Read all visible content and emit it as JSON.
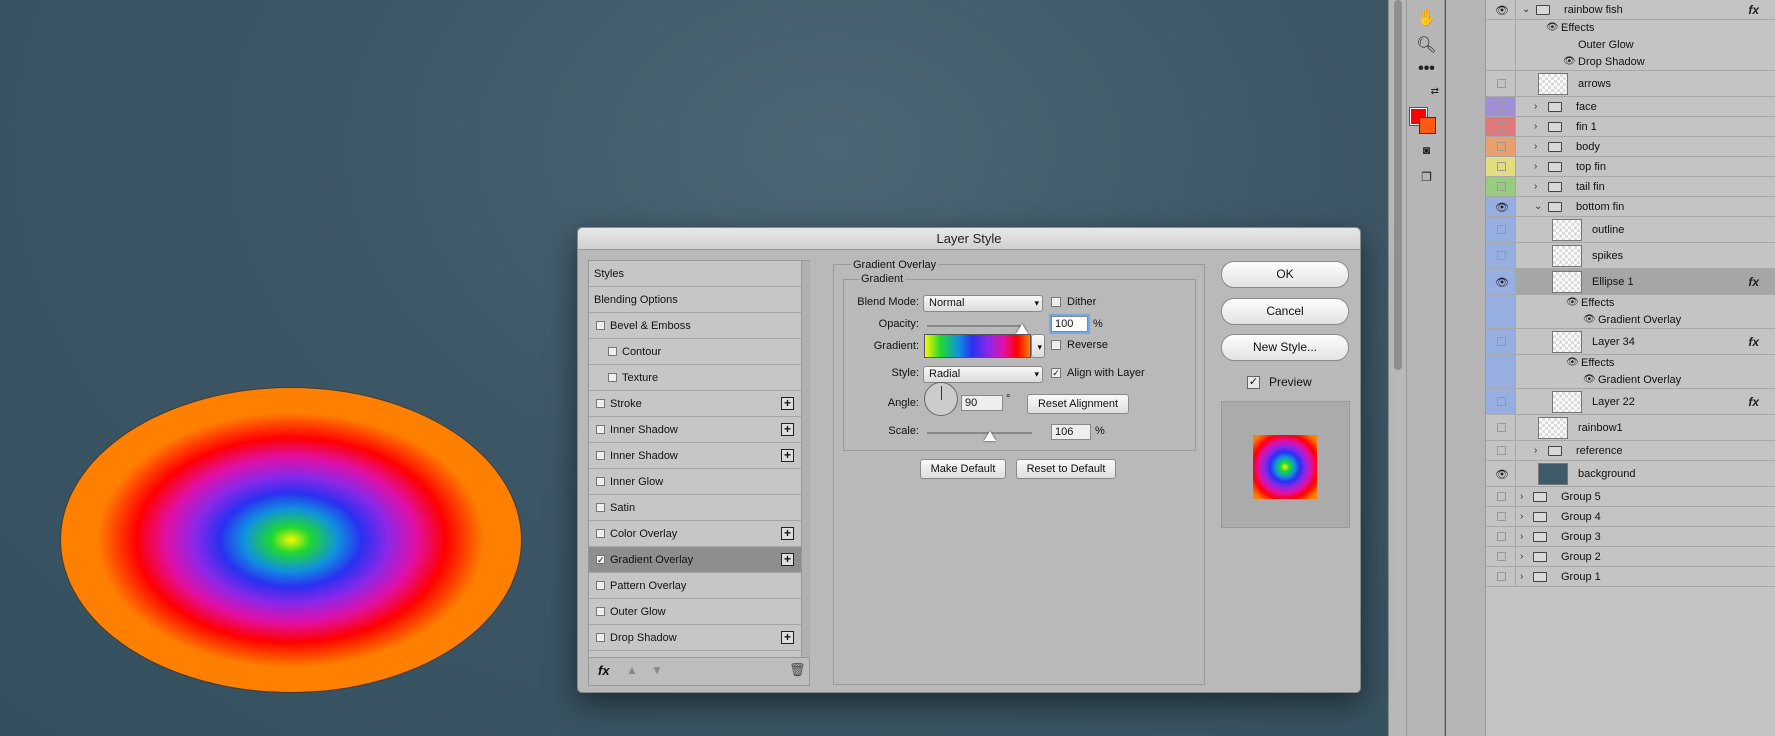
{
  "dialog": {
    "title": "Layer Style",
    "styles_list": [
      {
        "label": "Styles",
        "checkbox": false,
        "checked": false,
        "plus": false,
        "indent": 0,
        "selected": false
      },
      {
        "label": "Blending Options",
        "checkbox": false,
        "checked": false,
        "plus": false,
        "indent": 0,
        "selected": false
      },
      {
        "label": "Bevel & Emboss",
        "checkbox": true,
        "checked": false,
        "plus": false,
        "indent": 1,
        "selected": false
      },
      {
        "label": "Contour",
        "checkbox": true,
        "checked": false,
        "plus": false,
        "indent": 2,
        "selected": false
      },
      {
        "label": "Texture",
        "checkbox": true,
        "checked": false,
        "plus": false,
        "indent": 2,
        "selected": false
      },
      {
        "label": "Stroke",
        "checkbox": true,
        "checked": false,
        "plus": true,
        "indent": 1,
        "selected": false
      },
      {
        "label": "Inner Shadow",
        "checkbox": true,
        "checked": false,
        "plus": true,
        "indent": 1,
        "selected": false
      },
      {
        "label": "Inner Shadow",
        "checkbox": true,
        "checked": false,
        "plus": true,
        "indent": 1,
        "selected": false
      },
      {
        "label": "Inner Glow",
        "checkbox": true,
        "checked": false,
        "plus": false,
        "indent": 1,
        "selected": false
      },
      {
        "label": "Satin",
        "checkbox": true,
        "checked": false,
        "plus": false,
        "indent": 1,
        "selected": false
      },
      {
        "label": "Color Overlay",
        "checkbox": true,
        "checked": false,
        "plus": true,
        "indent": 1,
        "selected": false
      },
      {
        "label": "Gradient Overlay",
        "checkbox": true,
        "checked": true,
        "plus": true,
        "indent": 1,
        "selected": true
      },
      {
        "label": "Pattern Overlay",
        "checkbox": true,
        "checked": false,
        "plus": false,
        "indent": 1,
        "selected": false
      },
      {
        "label": "Outer Glow",
        "checkbox": true,
        "checked": false,
        "plus": false,
        "indent": 1,
        "selected": false
      },
      {
        "label": "Drop Shadow",
        "checkbox": true,
        "checked": false,
        "plus": true,
        "indent": 1,
        "selected": false
      }
    ],
    "footer": {
      "fx_label": "fx",
      "up_icon": "arrow-up-icon",
      "down_icon": "arrow-down-icon",
      "trash_icon": "trash-icon"
    },
    "section_title": "Gradient Overlay",
    "group_title": "Gradient",
    "blend_mode": {
      "label": "Blend Mode:",
      "value": "Normal"
    },
    "dither": {
      "label": "Dither",
      "checked": false
    },
    "opacity": {
      "label": "Opacity:",
      "value": "100",
      "unit": "%",
      "level": 1.0
    },
    "gradient": {
      "label": "Gradient:"
    },
    "reverse": {
      "label": "Reverse",
      "checked": false
    },
    "style": {
      "label": "Style:",
      "value": "Radial"
    },
    "align_with_layer": {
      "label": "Align with Layer",
      "checked": true
    },
    "angle": {
      "label": "Angle:",
      "value": "90",
      "unit": "°"
    },
    "reset_alignment": "Reset Alignment",
    "scale": {
      "label": "Scale:",
      "value": "106",
      "unit": "%",
      "level": 0.6
    },
    "make_default": "Make Default",
    "reset_to_default": "Reset to Default",
    "ok": "OK",
    "cancel": "Cancel",
    "new_style": "New Style...",
    "preview": {
      "label": "Preview",
      "checked": true
    }
  },
  "layers": [
    {
      "name": "rainbow fish",
      "kind": "group",
      "eye": true,
      "open": true,
      "fx": true,
      "color": ""
    },
    {
      "name": "Effects",
      "kind": "effects",
      "eye": true,
      "indent": 1
    },
    {
      "name": "Outer Glow",
      "kind": "effect",
      "eye": false,
      "indent": 2
    },
    {
      "name": "Drop Shadow",
      "kind": "effect",
      "eye": true,
      "indent": 2
    },
    {
      "name": "arrows",
      "kind": "layer",
      "eye": false,
      "color": ""
    },
    {
      "name": "face",
      "kind": "group",
      "eye": false,
      "open": false,
      "color": "#a08ed6"
    },
    {
      "name": "fin 1",
      "kind": "group",
      "eye": false,
      "open": false,
      "color": "#e07a7a"
    },
    {
      "name": "body",
      "kind": "group",
      "eye": false,
      "open": false,
      "color": "#e8a070"
    },
    {
      "name": "top fin",
      "kind": "group",
      "eye": false,
      "open": false,
      "color": "#e2dd80"
    },
    {
      "name": "tail fin",
      "kind": "group",
      "eye": false,
      "open": false,
      "color": "#98cc80"
    },
    {
      "name": "bottom fin",
      "kind": "group",
      "eye": true,
      "open": true,
      "color": "#96aee0"
    },
    {
      "name": "outline",
      "kind": "layer",
      "eye": false,
      "color": "#96aee0"
    },
    {
      "name": "spikes",
      "kind": "layer",
      "eye": false,
      "color": "#96aee0"
    },
    {
      "name": "Ellipse 1",
      "kind": "layer",
      "eye": true,
      "fx": true,
      "selected": true,
      "color": "#96aee0"
    },
    {
      "name": "Effects",
      "kind": "effects",
      "eye": true,
      "indent": 1,
      "color": "#96aee0"
    },
    {
      "name": "Gradient Overlay",
      "kind": "effect",
      "eye": true,
      "indent": 2,
      "color": "#96aee0"
    },
    {
      "name": "Layer 34",
      "kind": "layer",
      "eye": false,
      "fx": true,
      "color": "#96aee0"
    },
    {
      "name": "Effects",
      "kind": "effects",
      "eye": true,
      "indent": 1,
      "color": "#96aee0"
    },
    {
      "name": "Gradient Overlay",
      "kind": "effect",
      "eye": true,
      "indent": 2,
      "color": "#96aee0"
    },
    {
      "name": "Layer 22",
      "kind": "layer",
      "eye": false,
      "fx": true,
      "color": "#96aee0"
    },
    {
      "name": "rainbow1",
      "kind": "smart",
      "eye": false,
      "color": ""
    },
    {
      "name": "reference",
      "kind": "group",
      "eye": false,
      "open": false,
      "color": ""
    },
    {
      "name": "background",
      "kind": "smart",
      "eye": true,
      "color": ""
    },
    {
      "name": "Group 5",
      "kind": "group",
      "eye": false,
      "open": false,
      "color": ""
    },
    {
      "name": "Group 4",
      "kind": "group",
      "eye": false,
      "open": false,
      "color": ""
    },
    {
      "name": "Group 3",
      "kind": "group",
      "eye": false,
      "open": false,
      "color": ""
    },
    {
      "name": "Group 2",
      "kind": "group",
      "eye": false,
      "open": false,
      "color": ""
    },
    {
      "name": "Group 1",
      "kind": "group",
      "eye": false,
      "open": false,
      "color": ""
    }
  ],
  "tools": [
    "hand-icon",
    "zoom-icon",
    "more-icon",
    "swap-colors-icon",
    "quick-mask-icon",
    "screen-mode-icon"
  ],
  "colors": {
    "foreground": "#ff0000",
    "background": "#ff5a10"
  },
  "glyphs": {
    "expand": "›",
    "collapse": "⌄",
    "check": "✓",
    "eye": "●",
    "plus": "+",
    "dropdown": "▾"
  }
}
